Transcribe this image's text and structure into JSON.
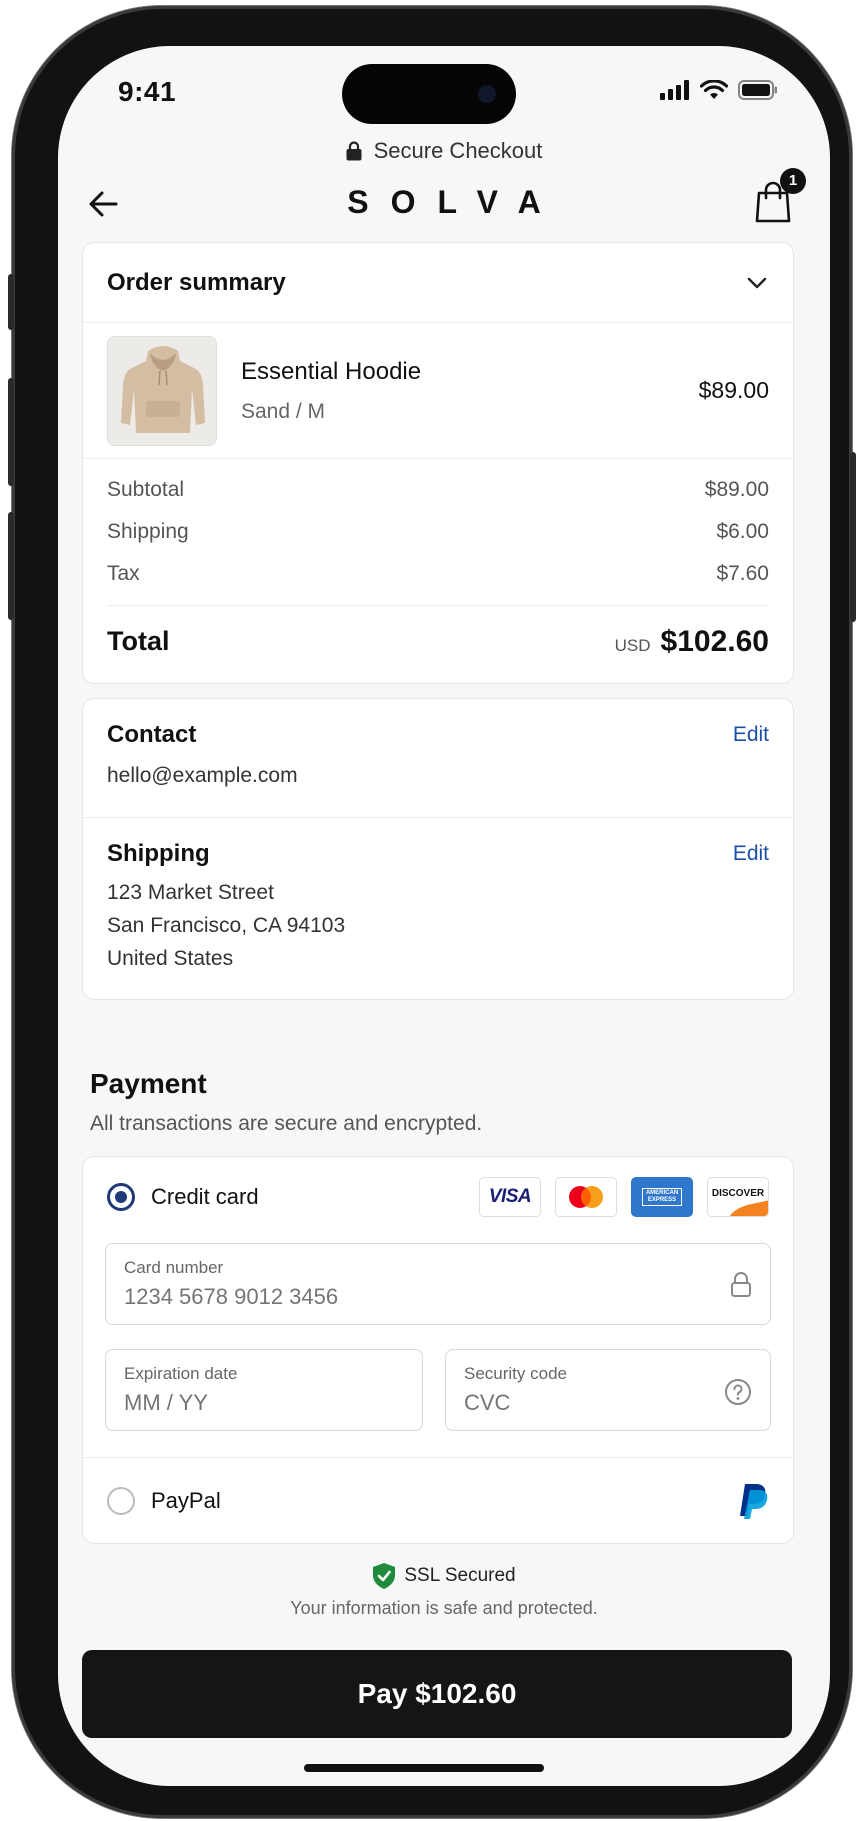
{
  "status_bar": {
    "time": "9:41"
  },
  "header": {
    "secure_label": "Secure Checkout",
    "brand": "SOLVA",
    "cart_count": "1"
  },
  "order_summary": {
    "title": "Order summary",
    "item": {
      "name": "Essential Hoodie",
      "variant": "Sand / M",
      "price": "$89.00"
    },
    "costs": [
      {
        "label": "Subtotal",
        "value": "$89.00"
      },
      {
        "label": "Shipping",
        "value": "$6.00"
      },
      {
        "label": "Tax",
        "value": "$7.60"
      }
    ],
    "total_label": "Total",
    "currency": "USD",
    "total_value": "$102.60"
  },
  "contact": {
    "title": "Contact",
    "edit": "Edit",
    "email": "hello@example.com"
  },
  "shipping": {
    "title": "Shipping",
    "edit": "Edit",
    "address": [
      "123 Market Street",
      "San Francisco, CA 94103",
      "United States"
    ]
  },
  "payment": {
    "title": "Payment",
    "subtitle": "All transactions are secure and encrypted.",
    "credit_card_label": "Credit card",
    "card_brands": [
      "VISA",
      "mastercard",
      "AMERICAN EXPRESS",
      "DISCOVER"
    ],
    "card_number": {
      "label": "Card number",
      "placeholder": "1234 5678 9012 3456"
    },
    "expiration": {
      "label": "Expiration date",
      "placeholder": "MM / YY"
    },
    "security_code": {
      "label": "Security code",
      "placeholder": "CVC"
    },
    "paypal_label": "PayPal",
    "selected_method": "Credit card"
  },
  "security": {
    "title": "SSL Secured",
    "subtitle": "Your information is safe and protected."
  },
  "pay_button": "Pay $102.60",
  "colors": {
    "accent_blue": "#1e4fa6",
    "radio_selected": "#1e3a78",
    "button_dark": "#151515",
    "ssl_green": "#1f8a3b"
  }
}
